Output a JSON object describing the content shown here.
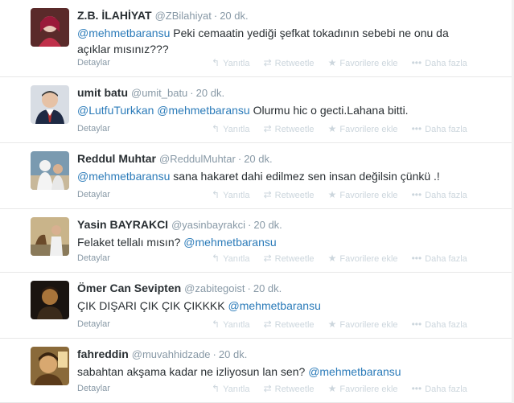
{
  "tweets": [
    {
      "fullname": "Z.B. İLAHİYAT",
      "username": "@ZBilahiyat",
      "time": "20 dk.",
      "mentions": [
        "@mehmetbaransu"
      ],
      "text": "Peki cemaatin yediği şefkat tokadının sebebi ne onu da açıklar mısınız???",
      "details": "Detaylar"
    },
    {
      "fullname": "umit batu",
      "username": "@umit_batu",
      "time": "20 dk.",
      "mentions": [
        "@LutfuTurkkan",
        "@mehmetbaransu"
      ],
      "text": "Olurmu hic o gecti.Lahana bitti.",
      "details": "Detaylar"
    },
    {
      "fullname": "Reddul Muhtar",
      "username": "@ReddulMuhtar",
      "time": "20 dk.",
      "mentions": [
        "@mehmetbaransu"
      ],
      "text": "sana hakaret dahi edilmez sen insan değilsin çünkü .!",
      "details": "Detaylar"
    },
    {
      "fullname": "Yasin BAYRAKCI",
      "username": "@yasinbayrakci",
      "time": "20 dk.",
      "text_before": "Felaket tellalı mısın?",
      "mentions_after": [
        "@mehmetbaransu"
      ],
      "details": "Detaylar"
    },
    {
      "fullname": "Ömer Can Sevipten",
      "username": "@zabitegoist",
      "time": "20 dk.",
      "text_before": "ÇIK DIŞARI ÇIK ÇIK ÇIKKKK",
      "mentions_after": [
        "@mehmetbaransu"
      ],
      "details": "Detaylar"
    },
    {
      "fullname": "fahreddin",
      "username": "@muvahhidzade",
      "time": "20 dk.",
      "text_before": "sabahtan akşama kadar ne izliyosun lan sen?",
      "mentions_after": [
        "@mehmetbaransu"
      ],
      "details": "Detaylar"
    }
  ],
  "actions": {
    "reply": "Yanıtla",
    "retweet": "Retweetle",
    "favorite": "Favorilere ekle",
    "more": "Daha fazla"
  },
  "icons": {
    "reply": "reply-arrow-icon",
    "retweet": "retweet-icon",
    "favorite": "star-icon",
    "more": "ellipsis-icon"
  },
  "colors": {
    "link": "#2b7bb9",
    "meta": "#8899a6",
    "action_muted": "#ccd6dd",
    "text": "#292f33"
  }
}
